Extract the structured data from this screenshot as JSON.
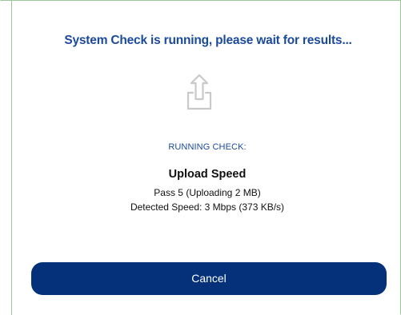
{
  "dialog": {
    "title": "System Check is running, please wait for results...",
    "icon": "upload-icon",
    "running_label": "RUNNING CHECK:",
    "check": {
      "name": "Upload Speed",
      "pass_text": "Pass 5 (Uploading 2 MB)",
      "speed_text": "Detected Speed: 3 Mbps (373 KB/s)"
    },
    "cancel_label": "Cancel"
  },
  "colors": {
    "accent": "#1b4a9c",
    "button": "#05317a",
    "border": "#9cc79a",
    "icon": "#c9c9c9"
  }
}
